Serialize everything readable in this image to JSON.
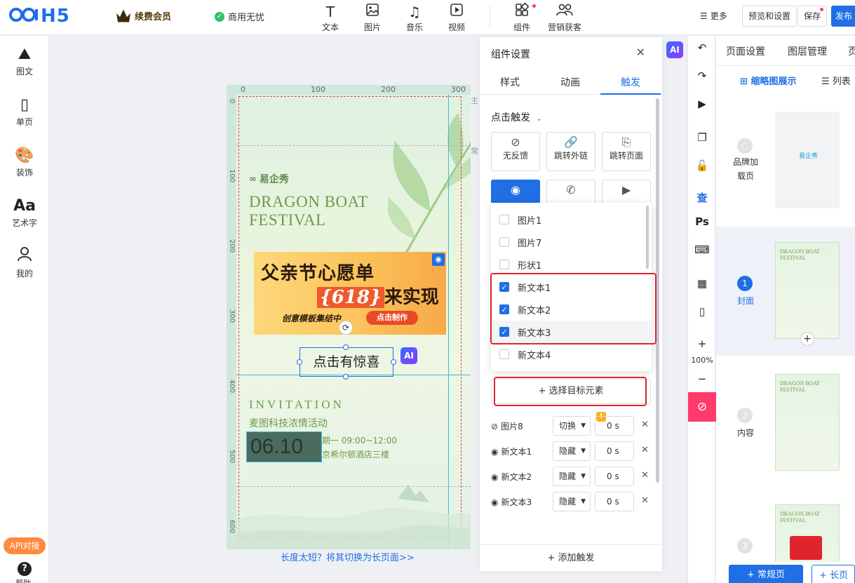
{
  "header": {
    "logo": "H5",
    "vip_label": "续费会员",
    "commerce_label": "商用无忧",
    "tools": [
      {
        "label": "文本",
        "icon": "text-icon"
      },
      {
        "label": "图片",
        "icon": "image-icon"
      },
      {
        "label": "音乐",
        "icon": "music-icon"
      },
      {
        "label": "视频",
        "icon": "video-icon"
      },
      {
        "label": "组件",
        "icon": "component-icon"
      },
      {
        "label": "营销获客",
        "icon": "marketing-icon"
      }
    ],
    "more_label": "更多",
    "preview_label": "预览和设置",
    "save_label": "保存",
    "publish_label": "发布"
  },
  "sidebar": {
    "items": [
      {
        "label": "图文",
        "icon": "image-text-icon"
      },
      {
        "label": "单页",
        "icon": "single-page-icon"
      },
      {
        "label": "装饰",
        "icon": "palette-icon"
      },
      {
        "label": "艺术字",
        "icon": "art-text-icon"
      },
      {
        "label": "我的",
        "icon": "user-icon"
      }
    ],
    "api_label": "API对接",
    "help_label": "帮助"
  },
  "canvas": {
    "ruler_top": [
      "0",
      "100",
      "200",
      "300"
    ],
    "ruler_left": [
      "0",
      "100",
      "200",
      "300",
      "400",
      "500",
      "600"
    ],
    "side_tags": [
      "主",
      "常"
    ],
    "brand": "易企秀",
    "festival_title": "DRAGON BOAT FESTIVAL",
    "banner": {
      "line1": "父亲节心愿单",
      "line2_num": "{618}",
      "line2_rest": "来实现",
      "line3": "创意模板集结中",
      "cta": "点击制作"
    },
    "selected_text": "点击有惊喜",
    "ai_label": "AI",
    "invitation": "INVITATION",
    "event_name": "麦图科技浓情活动",
    "date": "06.10",
    "time": "期一 09:00~12:00",
    "place": "京希尔顿酒店三楼",
    "long_page_link": "长度太短？将其切换为长页面>>"
  },
  "panel": {
    "title": "组件设置",
    "tabs": [
      "样式",
      "动画",
      "触发"
    ],
    "active_tab": "触发",
    "trigger_type": "点击触发",
    "trigger_buttons": [
      {
        "label": "无反馈",
        "icon": "no-feedback-icon"
      },
      {
        "label": "跳转外链",
        "icon": "link-icon"
      },
      {
        "label": "跳转页面",
        "icon": "page-jump-icon"
      },
      {
        "label": "",
        "icon": "eye-icon"
      },
      {
        "label": "",
        "icon": "phone-icon"
      },
      {
        "label": "",
        "icon": "play-icon"
      }
    ],
    "dropdown_items": [
      {
        "label": "图片1",
        "checked": false
      },
      {
        "label": "图片7",
        "checked": false
      },
      {
        "label": "形状1",
        "checked": false
      },
      {
        "label": "新文本1",
        "checked": true
      },
      {
        "label": "新文本2",
        "checked": true
      },
      {
        "label": "新文本3",
        "checked": true
      },
      {
        "label": "新文本4",
        "checked": false
      }
    ],
    "choose_target": "选择目标元素",
    "actions": [
      {
        "name": "图片8",
        "action": "切换",
        "duration": "0",
        "unit": "s",
        "icon": "eye-off-icon"
      },
      {
        "name": "新文本1",
        "action": "隐藏",
        "duration": "0",
        "unit": "s",
        "icon": "eye-icon"
      },
      {
        "name": "新文本2",
        "action": "隐藏",
        "duration": "0",
        "unit": "s",
        "icon": "eye-icon"
      },
      {
        "name": "新文本3",
        "action": "隐藏",
        "duration": "0",
        "unit": "s",
        "icon": "eye-icon"
      }
    ],
    "add_trigger": "添加触发",
    "ai_label": "AI"
  },
  "right_toolbar": {
    "zoom": "100%"
  },
  "pages": {
    "tabs": [
      "页面设置",
      "图层管理",
      "页"
    ],
    "view_thumb": "缩略图展示",
    "view_list": "列表",
    "items": [
      {
        "num": "",
        "label": "品牌加载页",
        "thumb_text": "易企秀"
      },
      {
        "num": "1",
        "label": "封面",
        "thumb_text": "DRAGON BOAT FESTIVAL"
      },
      {
        "num": "2",
        "label": "内容",
        "thumb_text": "DRAGON BOAT FESTIVAL"
      },
      {
        "num": "3",
        "label": "",
        "thumb_text": "DRAGON BOAT FESTIVAL"
      }
    ],
    "add_normal": "+ 常规页",
    "add_long": "+ 长页"
  },
  "colors": {
    "accent": "#1f6fe5",
    "alert": "#ff3b6b",
    "highlight_frame": "#e0242e"
  }
}
